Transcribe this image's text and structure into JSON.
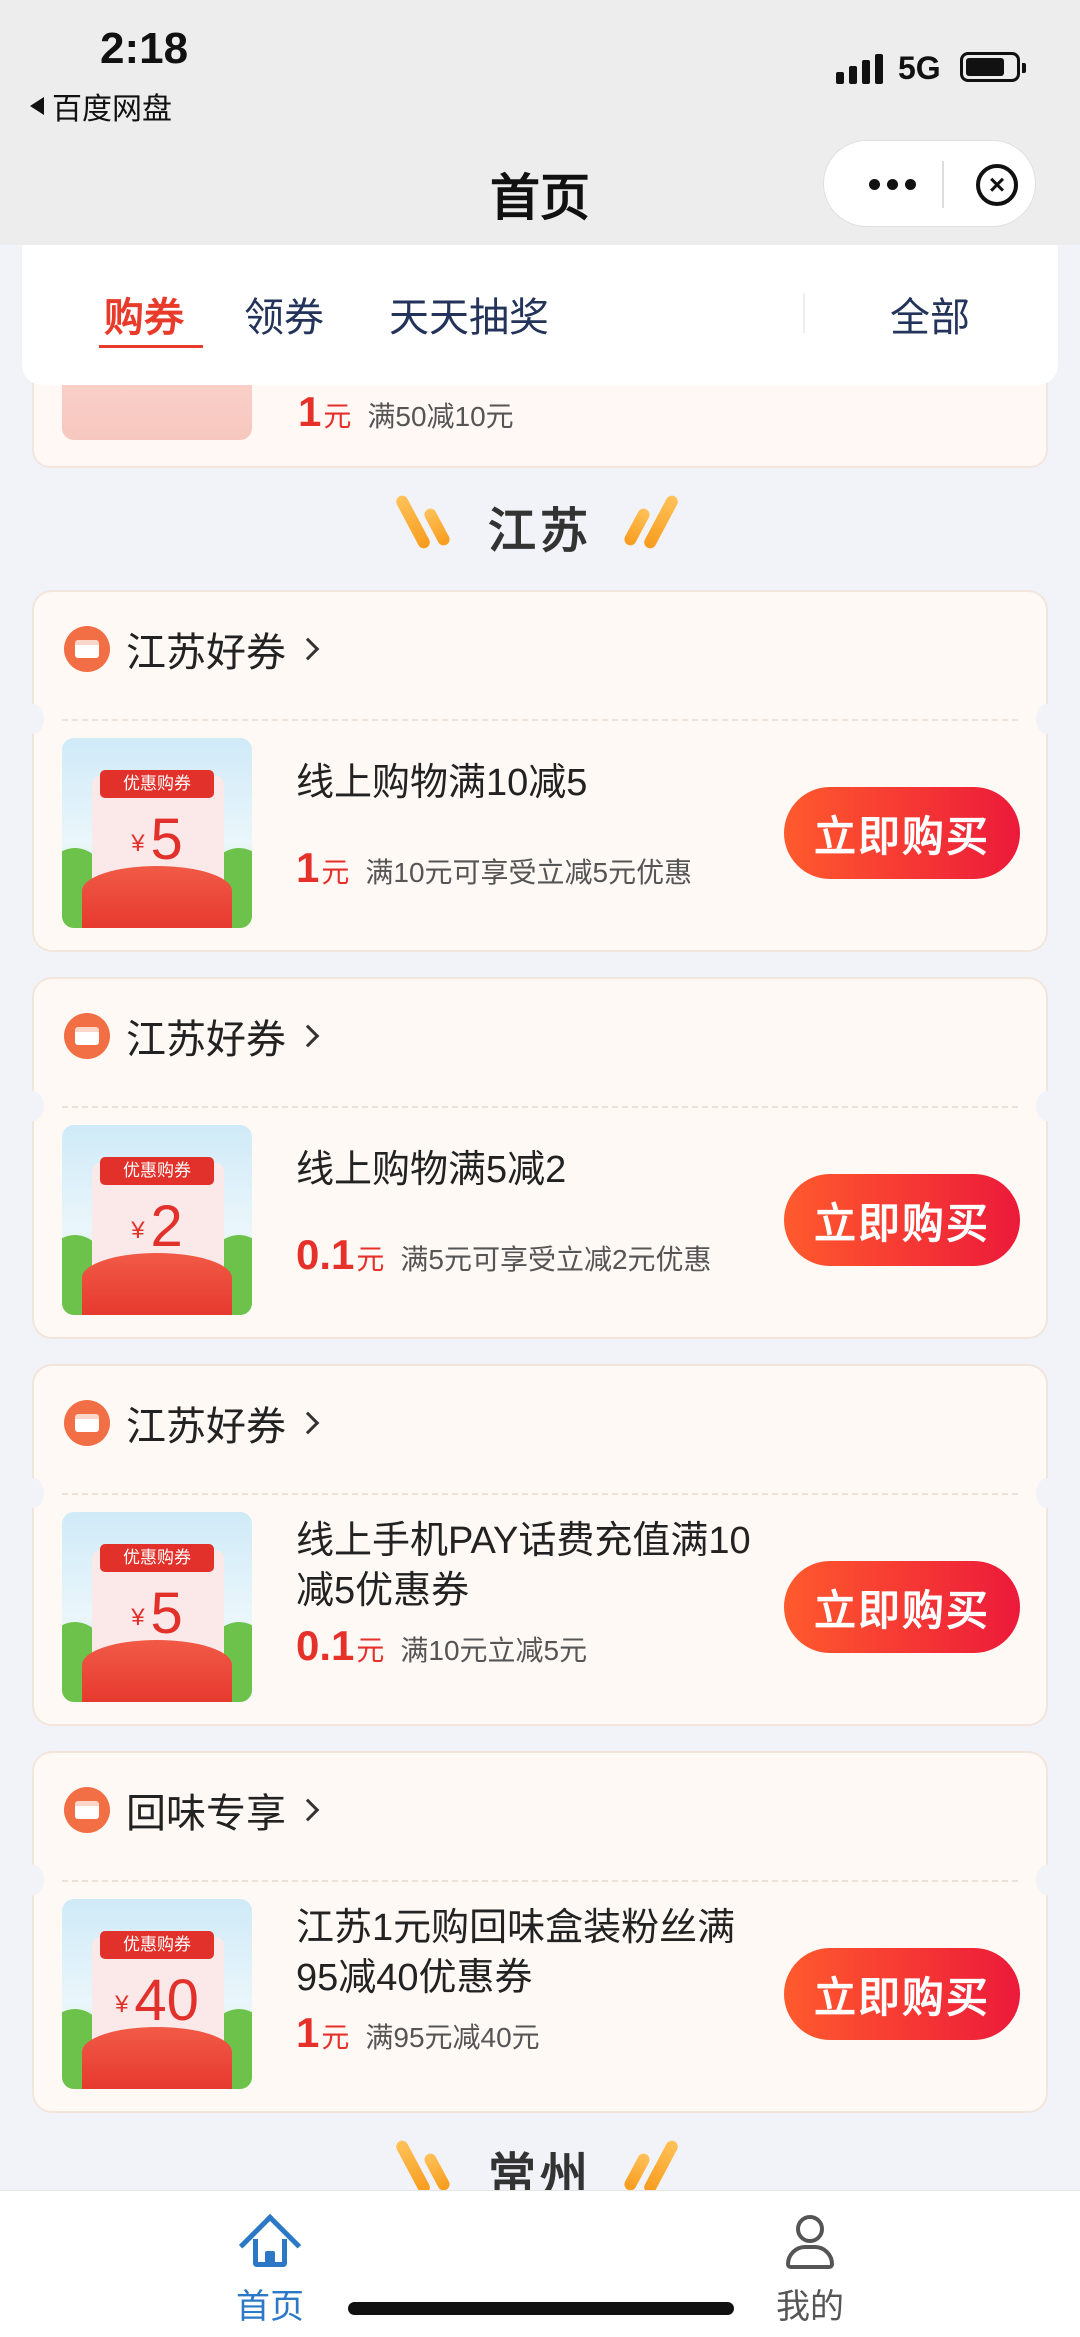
{
  "status_bar": {
    "time": "2:18",
    "back_app": "百度网盘",
    "network": "5G"
  },
  "title_bar": {
    "title": "首页"
  },
  "tabs": [
    {
      "label": "购券",
      "active": true
    },
    {
      "label": "领券",
      "active": false
    },
    {
      "label": "天天抽奖",
      "active": false
    },
    {
      "label": "全部",
      "active": false
    }
  ],
  "partial_card": {
    "price": "1",
    "unit": "元",
    "desc": "满50减10元"
  },
  "sections": [
    {
      "label": "江苏"
    },
    {
      "label": "常州"
    }
  ],
  "cards": [
    {
      "shop": "江苏好券",
      "badge": "优惠购券",
      "amount": "5",
      "title": "线上购物满10减5",
      "price": "1",
      "unit": "元",
      "desc": "满10元可享受立减5元优惠",
      "button": "立即购买"
    },
    {
      "shop": "江苏好券",
      "badge": "优惠购券",
      "amount": "2",
      "title": "线上购物满5减2",
      "price": "0.1",
      "unit": "元",
      "desc": "满5元可享受立减2元优惠",
      "button": "立即购买"
    },
    {
      "shop": "江苏好券",
      "badge": "优惠购券",
      "amount": "5",
      "title": "线上手机PAY话费充值满10减5优惠券",
      "price": "0.1",
      "unit": "元",
      "desc": "满10元立减5元",
      "button": "立即购买"
    },
    {
      "shop": "回味专享",
      "badge": "优惠购券",
      "amount": "40",
      "title": "江苏1元购回味盒装粉丝满95减40优惠券",
      "price": "1",
      "unit": "元",
      "desc": "满95元减40元",
      "button": "立即购买"
    }
  ],
  "currency_symbol": "¥",
  "bottom_nav": [
    {
      "label": "首页",
      "icon": "home-icon",
      "active": true,
      "color": "#2a78c6"
    },
    {
      "label": "我的",
      "icon": "user-icon",
      "active": false,
      "color": "#555555"
    }
  ],
  "colors": {
    "accent": "#e83b2b",
    "price": "#e6302a",
    "button": "#ff5a2d"
  }
}
